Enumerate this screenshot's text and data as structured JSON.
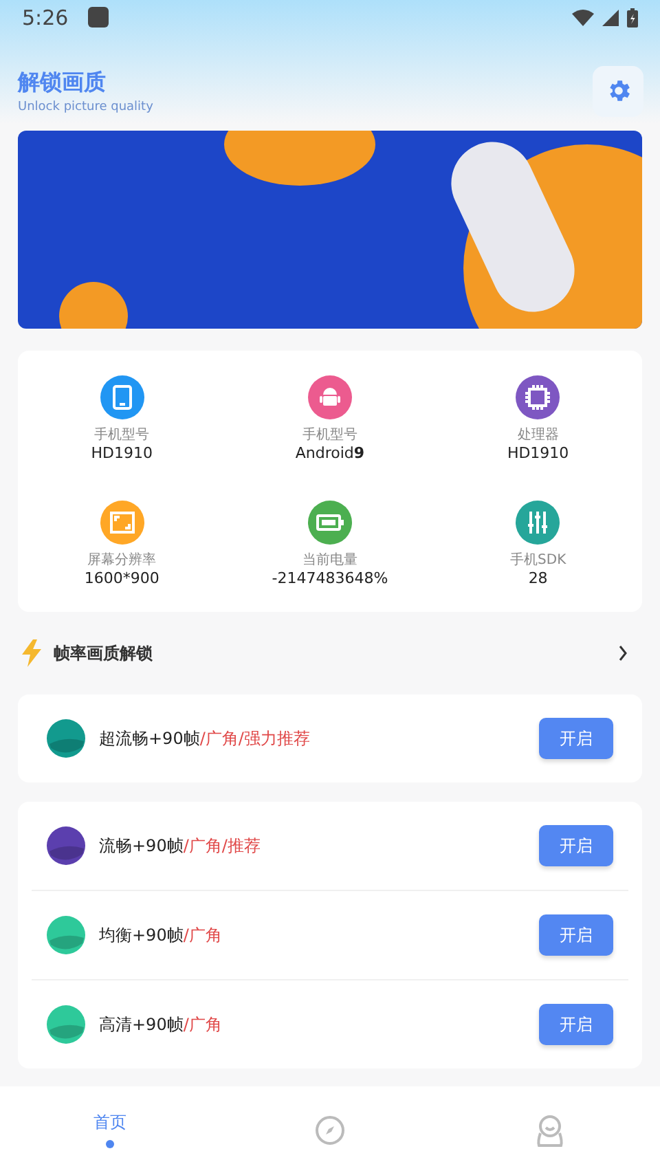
{
  "status_bar": {
    "time": "5:26"
  },
  "header": {
    "title": "解锁画质",
    "subtitle": "Unlock picture quality"
  },
  "device_info": [
    {
      "kind": "tablet",
      "color": "#2196f3",
      "label": "手机型号",
      "value": "HD1910"
    },
    {
      "kind": "android",
      "color": "#ec5b8f",
      "label": "手机型号",
      "value": "Android**9**"
    },
    {
      "kind": "chip",
      "color": "#7e57c2",
      "label": "处理器",
      "value": "HD1910"
    },
    {
      "kind": "screen",
      "color": "#ffa726",
      "label": "屏幕分辨率",
      "value": "1600*900"
    },
    {
      "kind": "battery",
      "color": "#4caf50",
      "label": "当前电量",
      "value": "-2147483648%"
    },
    {
      "kind": "sliders",
      "color": "#26a69a",
      "label": "手机SDK",
      "value": "28"
    }
  ],
  "section": {
    "title": "帧率画质解锁"
  },
  "mode_groups": [
    [
      {
        "name": "超流畅+90帧",
        "tags": "/广角/强力推荐",
        "color": "#129a8e",
        "button": "开启"
      }
    ],
    [
      {
        "name": "流畅+90帧",
        "tags": "/广角/推荐",
        "color": "#5b3fae",
        "button": "开启"
      },
      {
        "name": "均衡+90帧",
        "tags": "/广角",
        "color": "#2ec99a",
        "button": "开启"
      },
      {
        "name": "高清+90帧",
        "tags": "/广角",
        "color": "#2ec99a",
        "button": "开启"
      }
    ]
  ],
  "nav": [
    {
      "kind": "label",
      "label": "首页",
      "selected": true
    },
    {
      "kind": "compass",
      "selected": false
    },
    {
      "kind": "profile",
      "selected": false
    }
  ]
}
